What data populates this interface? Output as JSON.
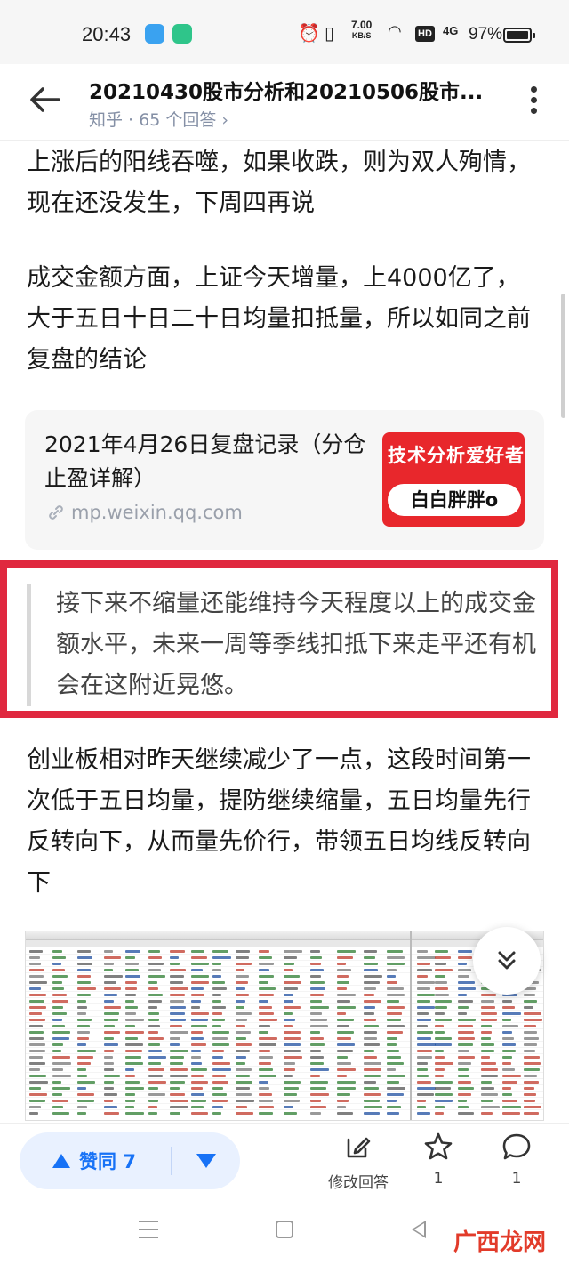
{
  "status_bar": {
    "time": "20:43",
    "net_speed_value": "7.00",
    "net_speed_unit": "KB/S",
    "hd_label": "HD",
    "signal_label": "4G",
    "battery": "97%"
  },
  "header": {
    "title": "20210430股市分析和20210506股市...",
    "source": "知乎 · 65 个回答 ›"
  },
  "article": {
    "para1": "上涨后的阳线吞噬，如果收跌，则为双人殉情，现在还没发生，下周四再说",
    "para2": "成交金额方面，上证今天增量，上4000亿了，大于五日十日二十日均量扣抵量，所以如同之前复盘的结论",
    "card": {
      "title": "2021年4月26日复盘记录（分仓止盈详解）",
      "link": "mp.weixin.qq.com",
      "thumb_line1": "技术分析爱好者",
      "thumb_line2": "白白胖胖o"
    },
    "quote": "接下来不缩量还能维持今天程度以上的成交金额水平，未来一周等季线扣抵下来走平还有机会在这附近晃悠。",
    "para3": "创业板相对昨天继续减少了一点，这段时间第一次低于五日均量，提防继续缩量，五日均量先行反转向下，从而量先价行，带领五日均线反转向下"
  },
  "actions": {
    "vote_up_label": "赞同 7",
    "edit_label": "修改回答",
    "fav_count": "1",
    "comment_count": "1"
  },
  "colors": {
    "accent_blue": "#1772f6",
    "highlight_red": "#e0283f",
    "thumb_red": "#e8272c"
  },
  "watermark": "广西龙网"
}
